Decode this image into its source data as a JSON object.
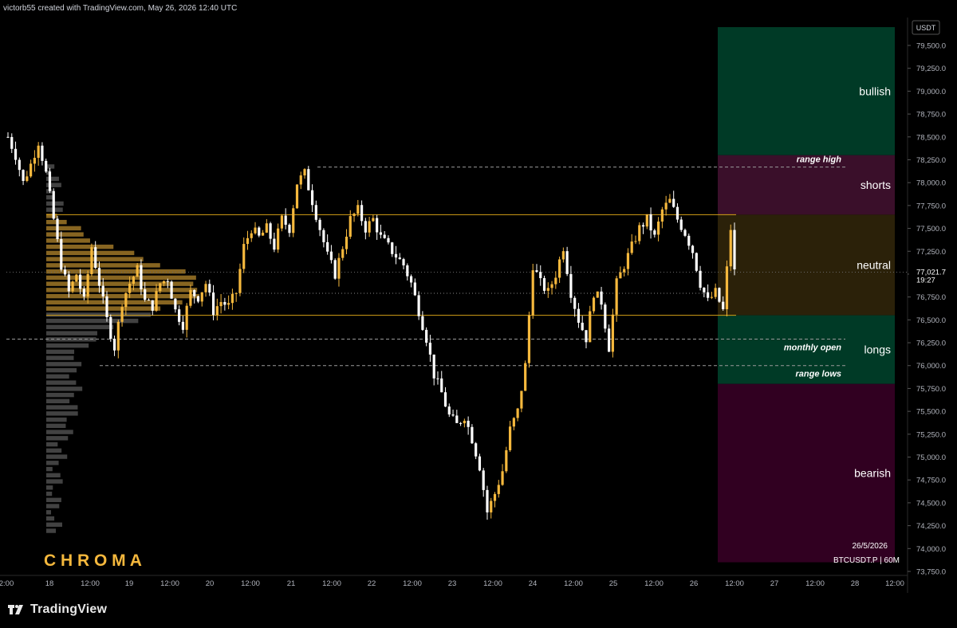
{
  "header": {
    "attribution": "victorb55 created with TradingView.com, May 26, 2026 12:40 UTC"
  },
  "footer": {
    "brand": "TradingView"
  },
  "watermark": {
    "text": "C H R O M A"
  },
  "symbol": {
    "label": "BTCUSDT.P | 60M",
    "date": "26/5/2026"
  },
  "colors": {
    "bull_candle": "#f5b83d",
    "bear_candle": "#ffffff",
    "level_line": "#d4a017",
    "dashed": "#9a9a9a",
    "accent": "#f5b83d"
  },
  "zones": [
    {
      "name": "bullish",
      "from": 78300,
      "to": 79700,
      "color": "#003a26"
    },
    {
      "name": "shorts",
      "from": 77650,
      "to": 78300,
      "color": "#3a0f2a"
    },
    {
      "name": "neutral",
      "from": 76550,
      "to": 77650,
      "color": "#2b2109"
    },
    {
      "name": "longs",
      "from": 75800,
      "to": 76550,
      "color": "#003a26"
    },
    {
      "name": "bearish",
      "from": 73850,
      "to": 75800,
      "color": "#310021"
    }
  ],
  "annotations": [
    {
      "text": "range high",
      "price": 78170
    },
    {
      "text": "monthly open",
      "price": 76290
    },
    {
      "text": "range lows",
      "price": 76000
    }
  ],
  "chart_data": {
    "type": "candlestick",
    "title": "",
    "xlabel": "",
    "ylabel": "USDT",
    "currency": "USDT",
    "ylim": [
      73750,
      79900
    ],
    "y_ticks": [
      "79,500.0",
      "79,250.0",
      "79,000.0",
      "78,750.0",
      "78,500.0",
      "78,250.0",
      "78,000.0",
      "77,750.0",
      "77,500.0",
      "77,250.0",
      "77,000.0",
      "76,750.0",
      "76,500.0",
      "76,250.0",
      "76,000.0",
      "75,750.0",
      "75,500.0",
      "75,250.0",
      "75,000.0",
      "74,750.0",
      "74,500.0",
      "74,250.0",
      "74,000.0",
      "73,750.0"
    ],
    "x_ticks": [
      "2:00",
      "18",
      "12:00",
      "19",
      "12:00",
      "20",
      "12:00",
      "21",
      "12:00",
      "22",
      "12:00",
      "23",
      "12:00",
      "24",
      "12:00",
      "25",
      "12:00",
      "26",
      "12:00",
      "27",
      "12:00",
      "28",
      "12:00"
    ],
    "last_price": {
      "label": "77,021.7",
      "countdown": "19:27",
      "value": 77021.7
    },
    "levels": [
      {
        "name": "range top",
        "price": 77650
      },
      {
        "name": "range bottom",
        "price": 76550
      },
      {
        "name": "range high",
        "price": 78170
      },
      {
        "name": "monthly open",
        "price": 76290
      },
      {
        "name": "range lows",
        "price": 76000
      }
    ],
    "anchors": [
      [
        0,
        78500
      ],
      [
        2,
        78300
      ],
      [
        4,
        78000
      ],
      [
        6,
        78200
      ],
      [
        8,
        78450
      ],
      [
        10,
        78100
      ],
      [
        12,
        77600
      ],
      [
        14,
        77100
      ],
      [
        16,
        76800
      ],
      [
        18,
        77000
      ],
      [
        20,
        76700
      ],
      [
        22,
        77300
      ],
      [
        24,
        76900
      ],
      [
        26,
        76500
      ],
      [
        28,
        76200
      ],
      [
        30,
        76700
      ],
      [
        32,
        76900
      ],
      [
        34,
        77050
      ],
      [
        36,
        76700
      ],
      [
        38,
        76650
      ],
      [
        40,
        76900
      ],
      [
        42,
        76950
      ],
      [
        44,
        76600
      ],
      [
        46,
        76450
      ],
      [
        48,
        76800
      ],
      [
        50,
        76750
      ],
      [
        52,
        76900
      ],
      [
        54,
        76600
      ],
      [
        56,
        76700
      ],
      [
        58,
        76650
      ],
      [
        60,
        76800
      ],
      [
        62,
        77300
      ],
      [
        64,
        77500
      ],
      [
        66,
        77400
      ],
      [
        68,
        77500
      ],
      [
        70,
        77300
      ],
      [
        72,
        77600
      ],
      [
        74,
        77500
      ],
      [
        76,
        78000
      ],
      [
        78,
        78100
      ],
      [
        80,
        77800
      ],
      [
        82,
        77500
      ],
      [
        84,
        77200
      ],
      [
        86,
        77000
      ],
      [
        88,
        77300
      ],
      [
        90,
        77600
      ],
      [
        92,
        77700
      ],
      [
        94,
        77500
      ],
      [
        96,
        77600
      ],
      [
        98,
        77400
      ],
      [
        100,
        77300
      ],
      [
        102,
        77200
      ],
      [
        104,
        77100
      ],
      [
        106,
        76900
      ],
      [
        108,
        76600
      ],
      [
        110,
        76300
      ],
      [
        112,
        75900
      ],
      [
        114,
        75700
      ],
      [
        116,
        75450
      ],
      [
        118,
        75350
      ],
      [
        120,
        75450
      ],
      [
        122,
        75200
      ],
      [
        124,
        74900
      ],
      [
        126,
        74400
      ],
      [
        128,
        74600
      ],
      [
        130,
        74850
      ],
      [
        132,
        75300
      ],
      [
        134,
        75500
      ],
      [
        136,
        76000
      ],
      [
        138,
        77100
      ],
      [
        140,
        76900
      ],
      [
        142,
        76800
      ],
      [
        144,
        77000
      ],
      [
        146,
        77300
      ],
      [
        148,
        76800
      ],
      [
        150,
        76500
      ],
      [
        152,
        76300
      ],
      [
        154,
        76800
      ],
      [
        156,
        76700
      ],
      [
        158,
        76200
      ],
      [
        160,
        76900
      ],
      [
        162,
        77100
      ],
      [
        164,
        77300
      ],
      [
        166,
        77500
      ],
      [
        168,
        77600
      ],
      [
        170,
        77400
      ],
      [
        172,
        77700
      ],
      [
        174,
        77800
      ],
      [
        176,
        77600
      ],
      [
        178,
        77450
      ],
      [
        180,
        77250
      ],
      [
        182,
        76900
      ],
      [
        184,
        76700
      ],
      [
        186,
        76800
      ],
      [
        188,
        76600
      ],
      [
        190,
        77500
      ],
      [
        191,
        77022
      ]
    ],
    "volume_profile_bins": 60
  }
}
